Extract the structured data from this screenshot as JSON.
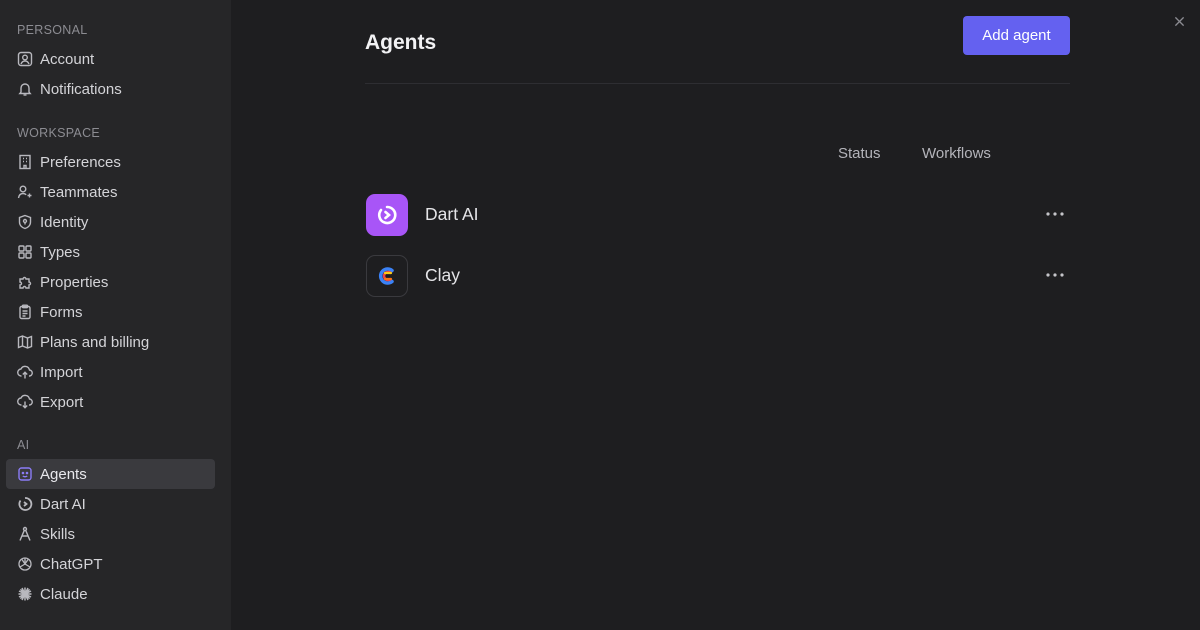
{
  "sidebar": {
    "sections": {
      "personal": "PERSONAL",
      "workspace": "WORKSPACE",
      "ai": "AI"
    },
    "personal_items": [
      {
        "label": "Account",
        "icon": "user-square-icon"
      },
      {
        "label": "Notifications",
        "icon": "bell-icon"
      }
    ],
    "workspace_items": [
      {
        "label": "Preferences",
        "icon": "building-icon"
      },
      {
        "label": "Teammates",
        "icon": "user-plus-icon"
      },
      {
        "label": "Identity",
        "icon": "shield-icon"
      },
      {
        "label": "Types",
        "icon": "grid-icon"
      },
      {
        "label": "Properties",
        "icon": "puzzle-icon"
      },
      {
        "label": "Forms",
        "icon": "clipboard-icon"
      },
      {
        "label": "Plans and billing",
        "icon": "map-icon"
      },
      {
        "label": "Import",
        "icon": "upload-cloud-icon"
      },
      {
        "label": "Export",
        "icon": "download-cloud-icon"
      }
    ],
    "ai_items": [
      {
        "label": "Agents",
        "icon": "bot-icon",
        "active": true
      },
      {
        "label": "Dart AI",
        "icon": "dart-icon"
      },
      {
        "label": "Skills",
        "icon": "compass-icon"
      },
      {
        "label": "ChatGPT",
        "icon": "openai-icon"
      },
      {
        "label": "Claude",
        "icon": "claude-icon"
      }
    ]
  },
  "main": {
    "title": "Agents",
    "add_button": "Add agent",
    "columns": {
      "status": "Status",
      "workflows": "Workflows"
    },
    "agents": [
      {
        "name": "Dart AI",
        "logo": "dart-logo"
      },
      {
        "name": "Clay",
        "logo": "clay-logo"
      }
    ]
  },
  "colors": {
    "accent": "#6461f0",
    "dart_logo": "#a855f7",
    "active_icon": "#8b7cf6"
  }
}
